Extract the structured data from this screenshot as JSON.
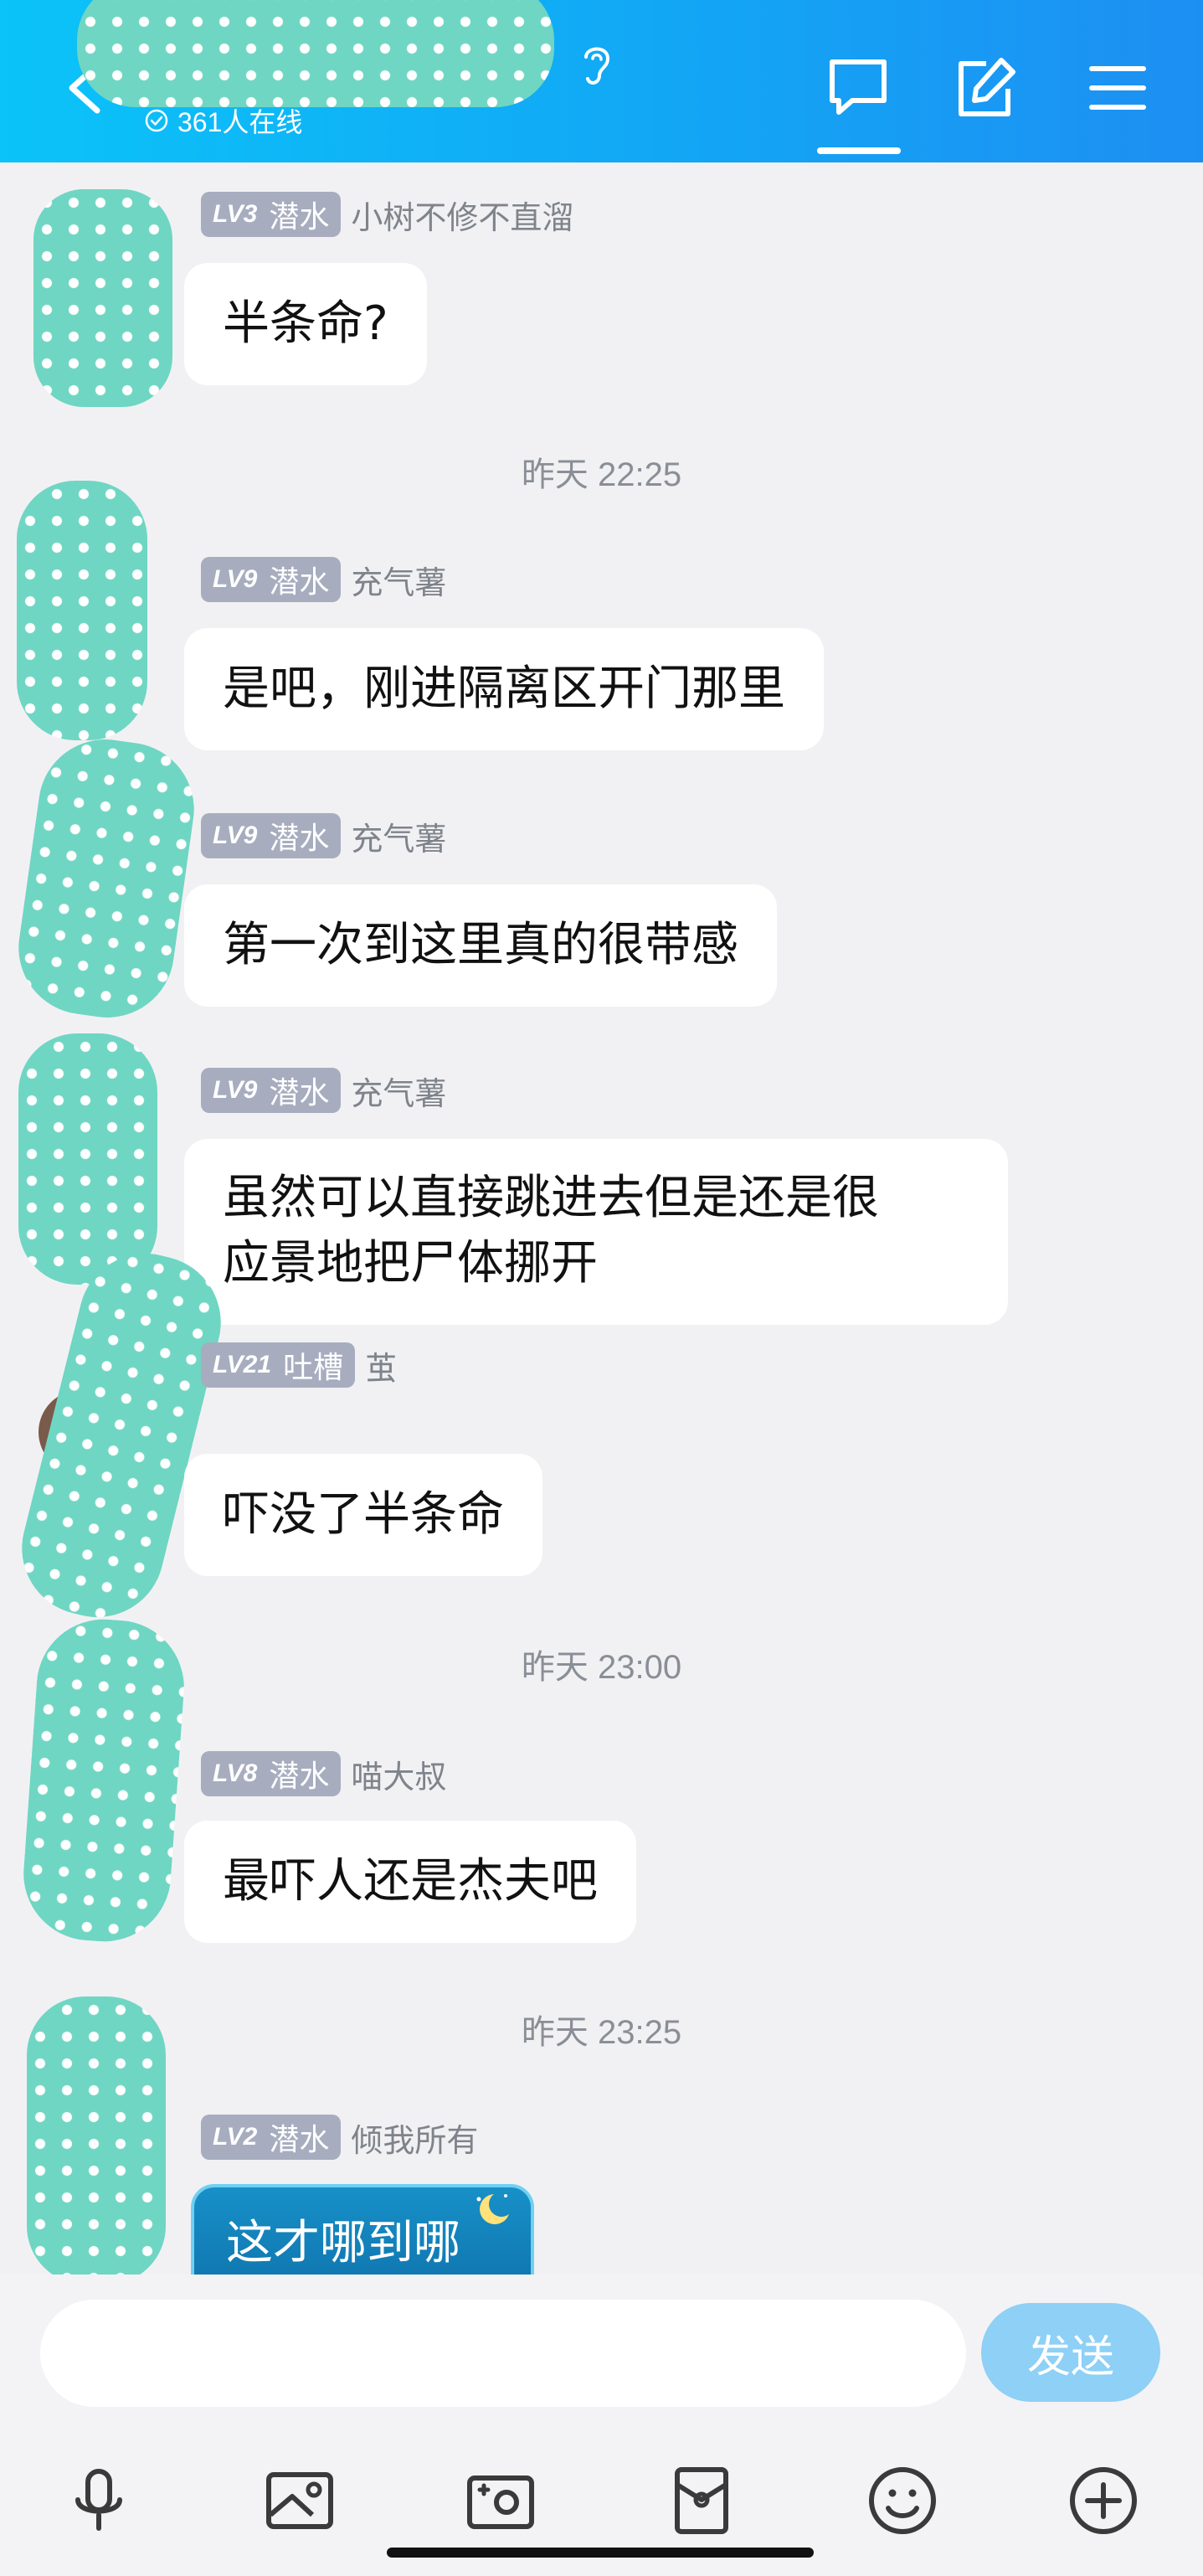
{
  "header": {
    "online_text": "361人在线",
    "icons": [
      "back-arrow-icon",
      "hearing-icon",
      "shield-check-icon",
      "chat-bubble-icon",
      "edit-icon",
      "menu-icon"
    ],
    "gradient_colors": [
      "#0bc3f8",
      "#1d8ff3"
    ]
  },
  "messages": [
    {
      "level": "LV3",
      "rank": "潜水",
      "name": "小树不修不直溜",
      "text": "半条命?"
    },
    {
      "timestamp": "昨天 22:25"
    },
    {
      "level": "LV9",
      "rank": "潜水",
      "name": "充气薯",
      "text": "是吧，刚进隔离区开门那里"
    },
    {
      "level": "LV9",
      "rank": "潜水",
      "name": "充气薯",
      "text": "第一次到这里真的很带感"
    },
    {
      "level": "LV9",
      "rank": "潜水",
      "name": "充气薯",
      "text_line1": "虽然可以直接跳进去但是还是很",
      "text_line2": "应景地把尸体挪开"
    },
    {
      "level": "LV21",
      "rank": "吐槽",
      "name": "茧",
      "text": "吓没了半条命"
    },
    {
      "timestamp": "昨天 23:00"
    },
    {
      "level": "LV8",
      "rank": "潜水",
      "name": "喵大叔",
      "text": "最吓人还是杰夫吧"
    },
    {
      "timestamp": "昨天 23:25"
    },
    {
      "level": "LV2",
      "rank": "潜水",
      "name": "倾我所有",
      "text": "这才哪到哪"
    }
  ],
  "input": {
    "send_label": "发送"
  },
  "toolbar": {
    "icons": [
      "microphone-icon",
      "image-icon",
      "camera-icon",
      "red-packet-icon",
      "emoji-icon",
      "plus-icon"
    ]
  },
  "colors": {
    "badge": "#a7adbf",
    "send_button": "#8ed0f6",
    "background": "#f1f1f3",
    "mask": "#6fd6c3"
  }
}
